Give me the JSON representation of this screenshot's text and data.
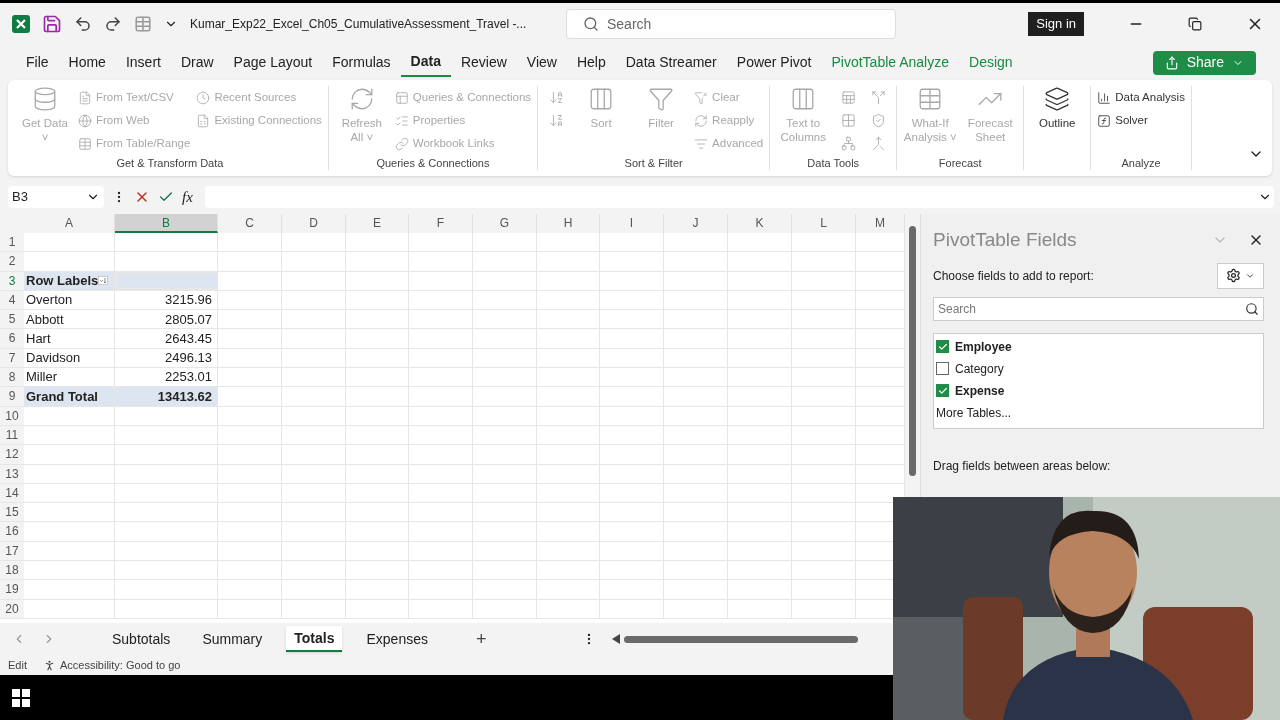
{
  "title_bar": {
    "file_name": "Kumar_Exp22_Excel_Ch05_CumulativeAssessment_Travel  -...",
    "search_placeholder": "Search",
    "sign_in": "Sign in"
  },
  "menu_tabs": [
    {
      "label": "File",
      "selected": false,
      "contextual": false
    },
    {
      "label": "Home",
      "selected": false,
      "contextual": false
    },
    {
      "label": "Insert",
      "selected": false,
      "contextual": false
    },
    {
      "label": "Draw",
      "selected": false,
      "contextual": false
    },
    {
      "label": "Page Layout",
      "selected": false,
      "contextual": false
    },
    {
      "label": "Formulas",
      "selected": false,
      "contextual": false
    },
    {
      "label": "Data",
      "selected": true,
      "contextual": false
    },
    {
      "label": "Review",
      "selected": false,
      "contextual": false
    },
    {
      "label": "View",
      "selected": false,
      "contextual": false
    },
    {
      "label": "Help",
      "selected": false,
      "contextual": false
    },
    {
      "label": "Data Streamer",
      "selected": false,
      "contextual": false
    },
    {
      "label": "Power Pivot",
      "selected": false,
      "contextual": false
    },
    {
      "label": "PivotTable Analyze",
      "selected": false,
      "contextual": true
    },
    {
      "label": "Design",
      "selected": false,
      "contextual": true
    }
  ],
  "share_button": "Share",
  "ribbon_groups": [
    {
      "label": "Get & Transform Data",
      "items": [
        {
          "label": "Get Data ˅",
          "kind": "large",
          "disabled": true
        },
        {
          "label": "From Text/CSV",
          "kind": "small",
          "disabled": true
        },
        {
          "label": "From Web",
          "kind": "small",
          "disabled": true
        },
        {
          "label": "From Table/Range",
          "kind": "small",
          "disabled": true
        },
        {
          "label": "Recent Sources",
          "kind": "small",
          "disabled": true
        },
        {
          "label": "Existing Connections",
          "kind": "small",
          "disabled": true
        }
      ]
    },
    {
      "label": "Queries & Connections",
      "items": [
        {
          "label": "Refresh All ˅",
          "kind": "large",
          "disabled": true
        },
        {
          "label": "Queries & Connections",
          "kind": "small",
          "disabled": true
        },
        {
          "label": "Properties",
          "kind": "small",
          "disabled": true
        },
        {
          "label": "Workbook Links",
          "kind": "small",
          "disabled": true
        }
      ]
    },
    {
      "label": "Sort & Filter",
      "items": [
        {
          "kind": "icon",
          "disabled": true
        },
        {
          "kind": "icon",
          "disabled": true
        },
        {
          "label": "Sort",
          "kind": "large",
          "disabled": true
        },
        {
          "label": "Filter",
          "kind": "large",
          "disabled": true
        },
        {
          "label": "Clear",
          "kind": "small",
          "disabled": true
        },
        {
          "label": "Reapply",
          "kind": "small",
          "disabled": true
        },
        {
          "label": "Advanced",
          "kind": "small",
          "disabled": true
        }
      ]
    },
    {
      "label": "Data Tools",
      "items": [
        {
          "label": "Text to Columns",
          "kind": "large",
          "disabled": true
        },
        {
          "kind": "icon",
          "disabled": true
        },
        {
          "kind": "icon",
          "disabled": true
        },
        {
          "kind": "icon",
          "disabled": true
        },
        {
          "kind": "icon",
          "disabled": true
        },
        {
          "kind": "icon",
          "disabled": true
        },
        {
          "kind": "icon",
          "disabled": true
        }
      ]
    },
    {
      "label": "Forecast",
      "items": [
        {
          "label": "What-If Analysis ˅",
          "kind": "large",
          "disabled": true
        },
        {
          "label": "Forecast Sheet",
          "kind": "large",
          "disabled": true
        }
      ]
    },
    {
      "items": [
        {
          "label": "Outline",
          "kind": "large",
          "disabled": false
        }
      ]
    },
    {
      "label": "Analyze",
      "items": [
        {
          "label": "Data Analysis",
          "kind": "small",
          "disabled": false
        },
        {
          "label": "Solver",
          "kind": "small",
          "disabled": false
        }
      ]
    }
  ],
  "formula_bar": {
    "name_box": "B3",
    "fx": "fx"
  },
  "columns": [
    {
      "label": "A",
      "selected": false
    },
    {
      "label": "B",
      "selected": true
    },
    {
      "label": "C",
      "selected": false
    },
    {
      "label": "D",
      "selected": false
    },
    {
      "label": "E",
      "selected": false
    },
    {
      "label": "F",
      "selected": false
    },
    {
      "label": "G",
      "selected": false
    },
    {
      "label": "H",
      "selected": false
    },
    {
      "label": "I",
      "selected": false
    },
    {
      "label": "J",
      "selected": false
    },
    {
      "label": "K",
      "selected": false
    },
    {
      "label": "L",
      "selected": false
    },
    {
      "label": "M",
      "selected": false
    }
  ],
  "rows": [
    {
      "number": "1",
      "kind": "blank",
      "selected": false
    },
    {
      "number": "2",
      "kind": "blank",
      "selected": false
    },
    {
      "number": "3",
      "kind": "pivot_header",
      "label": "Row Labels",
      "selected": true
    },
    {
      "number": "4",
      "kind": "item",
      "label": "Overton",
      "value": "3215.96",
      "selected": false
    },
    {
      "number": "5",
      "kind": "item",
      "label": "Abbott",
      "value": "2805.07",
      "selected": false
    },
    {
      "number": "6",
      "kind": "item",
      "label": "Hart",
      "value": "2643.45",
      "selected": false
    },
    {
      "number": "7",
      "kind": "item",
      "label": "Davidson",
      "value": "2496.13",
      "selected": false
    },
    {
      "number": "8",
      "kind": "item",
      "label": "Miller",
      "value": "2253.01",
      "selected": false
    },
    {
      "number": "9",
      "kind": "total",
      "label": "Grand Total",
      "value": "13413.62",
      "selected": false
    },
    {
      "number": "10",
      "kind": "blank",
      "selected": false
    },
    {
      "number": "11",
      "kind": "blank",
      "selected": false
    },
    {
      "number": "12",
      "kind": "blank",
      "selected": false
    },
    {
      "number": "13",
      "kind": "blank",
      "selected": false
    },
    {
      "number": "14",
      "kind": "blank",
      "selected": false
    },
    {
      "number": "15",
      "kind": "blank",
      "selected": false
    },
    {
      "number": "16",
      "kind": "blank",
      "selected": false
    },
    {
      "number": "17",
      "kind": "blank",
      "selected": false
    },
    {
      "number": "18",
      "kind": "blank",
      "selected": false
    },
    {
      "number": "19",
      "kind": "blank",
      "selected": false
    },
    {
      "number": "20",
      "kind": "blank",
      "selected": false
    }
  ],
  "sheet_tabs": [
    {
      "label": "Subtotals",
      "selected": false
    },
    {
      "label": "Summary",
      "selected": false
    },
    {
      "label": "Totals",
      "selected": true
    },
    {
      "label": "Expenses",
      "selected": false
    }
  ],
  "add_sheet": "+",
  "status_bar": {
    "mode": "Edit",
    "accessibility": "Accessibility: Good to go"
  },
  "pivot_panel": {
    "title": "PivotTable Fields",
    "prompt": "Choose fields to add to report:",
    "search_placeholder": "Search",
    "fields": [
      {
        "label": "Employee",
        "checked": true
      },
      {
        "label": "Category",
        "checked": false
      },
      {
        "label": "Expense",
        "checked": true
      }
    ],
    "more_tables": "More Tables...",
    "drag_hint": "Drag fields between areas below:"
  }
}
